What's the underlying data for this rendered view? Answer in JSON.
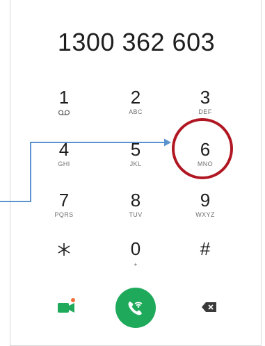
{
  "dialer": {
    "number": "1300 362 603",
    "keys": [
      {
        "digit": "1",
        "letters": ""
      },
      {
        "digit": "2",
        "letters": "ABC"
      },
      {
        "digit": "3",
        "letters": "DEF"
      },
      {
        "digit": "4",
        "letters": "GHI"
      },
      {
        "digit": "5",
        "letters": "JKL"
      },
      {
        "digit": "6",
        "letters": "MNO"
      },
      {
        "digit": "7",
        "letters": "PQRS"
      },
      {
        "digit": "8",
        "letters": "TUV"
      },
      {
        "digit": "9",
        "letters": "WXYZ"
      },
      {
        "digit": "*",
        "letters": ""
      },
      {
        "digit": "0",
        "letters": "+"
      },
      {
        "digit": "#",
        "letters": ""
      }
    ],
    "icons": {
      "voicemail": "voicemail-icon",
      "video_call": "video-call-icon",
      "call": "wifi-call-icon",
      "backspace": "backspace-icon"
    },
    "colors": {
      "call_green": "#1faa5b",
      "video_green": "#1faa5b",
      "video_dot": "#f26b3a",
      "highlight_red": "#b01722",
      "arrow_blue": "#5b93cf"
    }
  }
}
